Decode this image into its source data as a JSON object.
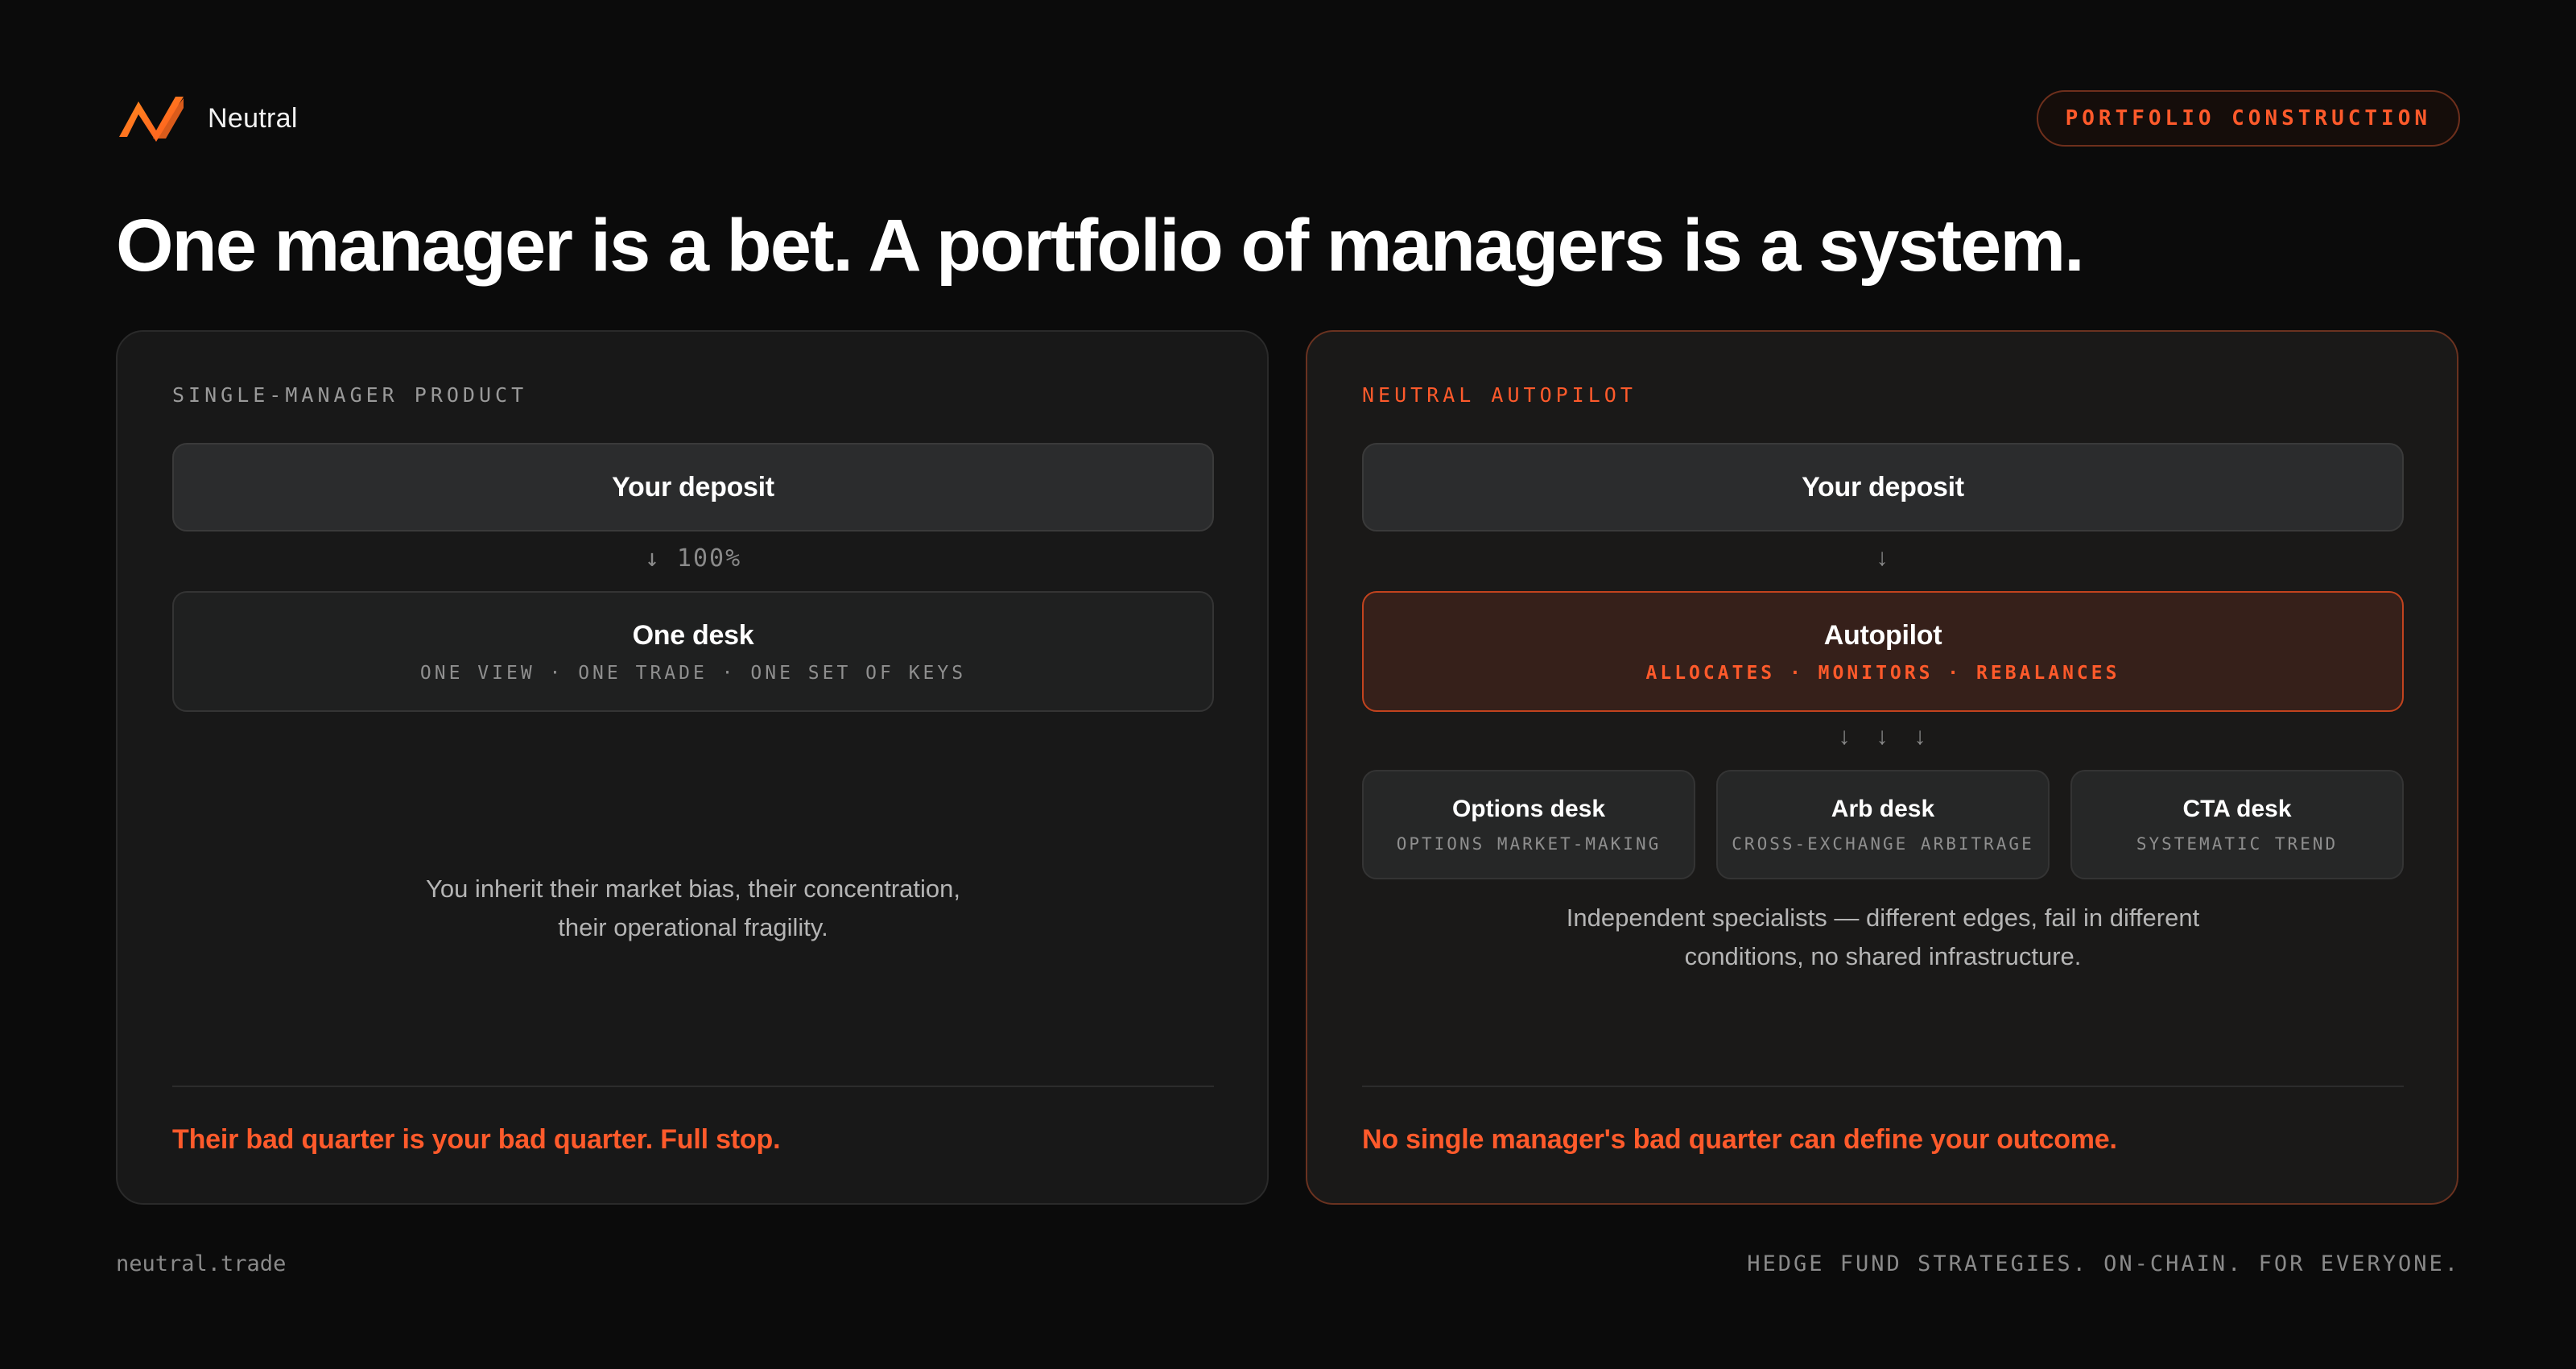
{
  "brand": {
    "name": "Neutral",
    "accent_color": "#ff5a2b",
    "logo_icon": "neutral-logo-icon"
  },
  "badge": {
    "label": "PORTFOLIO CONSTRUCTION"
  },
  "headline": "One manager is a bet. A portfolio of managers is a system.",
  "left_panel": {
    "label": "SINGLE-MANAGER PRODUCT",
    "deposit": "Your deposit",
    "connector": "↓ 100%",
    "desk": {
      "title": "One desk",
      "subtitle": "ONE VIEW · ONE TRADE · ONE SET OF KEYS"
    },
    "body_line1": "You inherit their market bias, their concentration,",
    "body_line2": "their operational fragility.",
    "footer": "Their bad quarter is your bad quarter. Full stop."
  },
  "right_panel": {
    "label": "NEUTRAL AUTOPILOT",
    "deposit": "Your deposit",
    "connector": "↓",
    "autopilot": {
      "title": "Autopilot",
      "subtitle": "ALLOCATES · MONITORS · REBALANCES"
    },
    "fanout_arrows": [
      "↓",
      "↓",
      "↓"
    ],
    "desks": [
      {
        "title": "Options desk",
        "subtitle": "OPTIONS MARKET-MAKING"
      },
      {
        "title": "Arb desk",
        "subtitle": "CROSS-EXCHANGE ARBITRAGE"
      },
      {
        "title": "CTA desk",
        "subtitle": "SYSTEMATIC TREND"
      }
    ],
    "body_line1": "Independent specialists — different edges, fail in different",
    "body_line2": "conditions, no shared infrastructure.",
    "footer": "No single manager's bad quarter can define your outcome."
  },
  "footer": {
    "site": "neutral.trade",
    "tagline": "HEDGE FUND STRATEGIES. ON-CHAIN. FOR EVERYONE."
  }
}
